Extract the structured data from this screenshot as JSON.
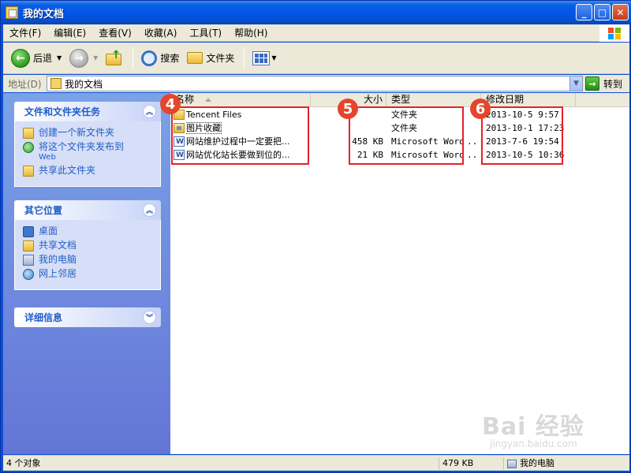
{
  "window": {
    "title": "我的文档"
  },
  "menu": {
    "items": [
      "文件(F)",
      "编辑(E)",
      "查看(V)",
      "收藏(A)",
      "工具(T)",
      "帮助(H)"
    ]
  },
  "toolbar": {
    "back_label": "后退",
    "search_label": "搜索",
    "folders_label": "文件夹"
  },
  "address": {
    "label": "地址(D)",
    "value": "我的文档",
    "go_label": "转到"
  },
  "tasks_panel": {
    "title": "文件和文件夹任务",
    "links": [
      {
        "label": "创建一个新文件夹",
        "sub": ""
      },
      {
        "label": "将这个文件夹发布到",
        "sub": "Web"
      },
      {
        "label": "共享此文件夹",
        "sub": ""
      }
    ]
  },
  "other_places": {
    "title": "其它位置",
    "links": [
      "桌面",
      "共享文档",
      "我的电脑",
      "网上邻居"
    ]
  },
  "details_panel": {
    "title": "详细信息"
  },
  "columns": {
    "name": "名称",
    "size": "大小",
    "type": "类型",
    "modified": "修改日期"
  },
  "files": [
    {
      "name": "Tencent Files",
      "size": "",
      "type": "文件夹",
      "modified": "2013-10-5 9:57",
      "icon": "folder-icon"
    },
    {
      "name": "图片收藏",
      "size": "",
      "type": "文件夹",
      "modified": "2013-10-1 17:23",
      "icon": "pictures-folder-icon"
    },
    {
      "name": "网站维护过程中一定要把...",
      "size": "458 KB",
      "type": "Microsoft Word",
      "modified": "2013-7-6 19:54",
      "icon": "word-document-icon"
    },
    {
      "name": "网站优化站长要做到位的...",
      "size": "21 KB",
      "type": "Microsoft Word",
      "modified": "2013-10-5 10:36",
      "icon": "word-document-icon"
    }
  ],
  "type_truncation": "...",
  "annotations": [
    "4",
    "5",
    "6"
  ],
  "statusbar": {
    "count": "4 个对象",
    "size": "479 KB",
    "location": "我的电脑"
  },
  "watermark": {
    "text": "Bai 经验",
    "sub": "jingyan.baidu.com"
  },
  "colors": {
    "annotation_red": "#e8202a",
    "badge_red": "#e4462c",
    "taskpane_blue": "#215dc6"
  }
}
